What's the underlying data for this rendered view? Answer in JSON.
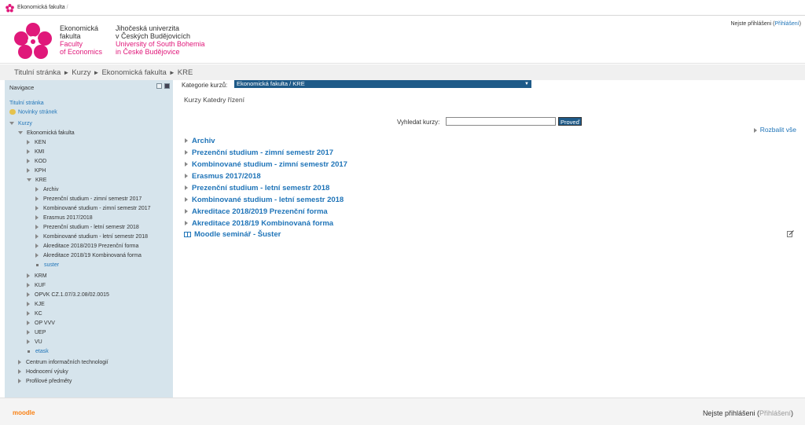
{
  "topbar": {
    "site_label": "Ekonomická fakulta",
    "separator": "/"
  },
  "header": {
    "col1": [
      "Ekonomická",
      "fakulta"
    ],
    "col1_en": [
      "Faculty",
      "of Economics"
    ],
    "col2": [
      "Jihočeská univerzita",
      "v Českých Budějovicích"
    ],
    "col2_en": [
      "University of South Bohemia",
      "in České Budějovice"
    ],
    "login_prefix": "Nejste přihlášeni (",
    "login_link": "Přihlášení",
    "login_suffix": ")"
  },
  "breadcrumb": [
    "Titulní stránka",
    "Kurzy",
    "Ekonomická fakulta",
    "KRE"
  ],
  "sidebar": {
    "title": "Navigace",
    "home": "Titulní stránka",
    "news": "Novinky stránek",
    "courses": "Kurzy",
    "faculty": "Ekonomická fakulta",
    "depts_top": [
      "KEN",
      "KMI",
      "KOD",
      "KPH"
    ],
    "kre": "KRE",
    "kre_children": [
      "Archiv",
      "Prezenční studium - zimní semestr 2017",
      "Kombinované studium - zimní semestr 2017",
      "Erasmus 2017/2018",
      "Prezenční studium - letní semestr 2018",
      "Kombinované studium - letní semestr 2018",
      "Akreditace 2018/2019 Prezenční forma",
      "Akreditace 2018/19 Kombinovaná forma"
    ],
    "kre_course": "suster",
    "depts_bottom": [
      "KRM",
      "KUF",
      "OPVK CZ.1.07/3.2.08/02.0015",
      "KJE",
      "KC",
      "OP VVV",
      "UEP",
      "VU"
    ],
    "etask": "etask",
    "other": [
      "Centrum informačních technologií",
      "Hodnocení výuky",
      "Profilové předměty"
    ]
  },
  "main": {
    "category_label": "Kategorie kurzů:",
    "category_value": "Ekonomická fakulta / KRE",
    "heading": "Kurzy Katedry řízení",
    "search_label": "Vyhledat kurzy:",
    "search_value": "",
    "search_button": "Proveď",
    "expand_all": "Rozbalit vše",
    "categories": [
      "Archiv",
      "Prezenční studium - zimní semestr 2017",
      "Kombinované studium - zimní semestr 2017",
      "Erasmus 2017/2018",
      "Prezenční studium - letní semestr 2018",
      "Kombinované studium - letní semestr 2018",
      "Akreditace 2018/2019 Prezenční forma",
      "Akreditace 2018/19 Kombinovaná forma"
    ],
    "course": "Moodle seminář - Šuster"
  },
  "footer": {
    "logo": "moodle",
    "login_prefix": "Nejste přihlášeni (",
    "login_link": "Přihlášení",
    "login_suffix": ")"
  },
  "colors": {
    "accent": "#1f74b8",
    "brand_pink": "#e0187a",
    "sidebar": "#d6e4ec",
    "select": "#1e5a88"
  }
}
